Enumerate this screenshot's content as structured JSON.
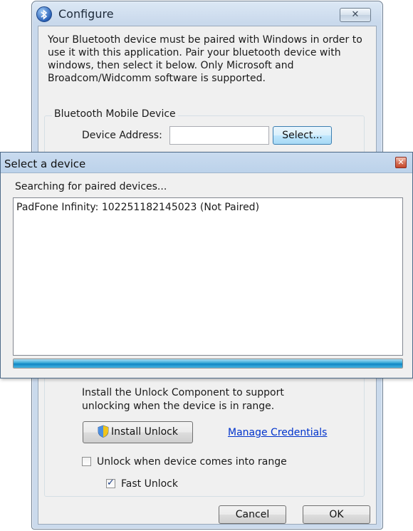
{
  "configure": {
    "title": "Configure",
    "close_symbol": "✕",
    "intro_text": "Your Bluetooth device must be paired with Windows in order to use it with this application.  Pair your bluetooth device with windows, then select it below.  Only Microsoft and Broadcom/Widcomm software is supported.",
    "group_title": "Bluetooth Mobile Device",
    "device_address_label": "Device Address:",
    "device_address_value": "",
    "select_button": "Select...",
    "install_text": "Install the Unlock Component to support unlocking when the device is in range.",
    "install_button": "Install Unlock",
    "manage_credentials_link": "Manage Credentials",
    "unlock_range_label": "Unlock when device comes into range",
    "unlock_range_checked": false,
    "fast_unlock_label": "Fast Unlock",
    "fast_unlock_checked": true,
    "cancel_button": "Cancel",
    "ok_button": "OK"
  },
  "select_dialog": {
    "title": "Select a device",
    "close_symbol": "✕",
    "status_text": "Searching for paired devices...",
    "devices": [
      "PadFone Infinity: 102251182145023 (Not Paired)"
    ],
    "progress_percent": 100
  },
  "icons": {
    "title_icon": "bluetooth-icon",
    "install_icon": "uac-shield-icon"
  }
}
